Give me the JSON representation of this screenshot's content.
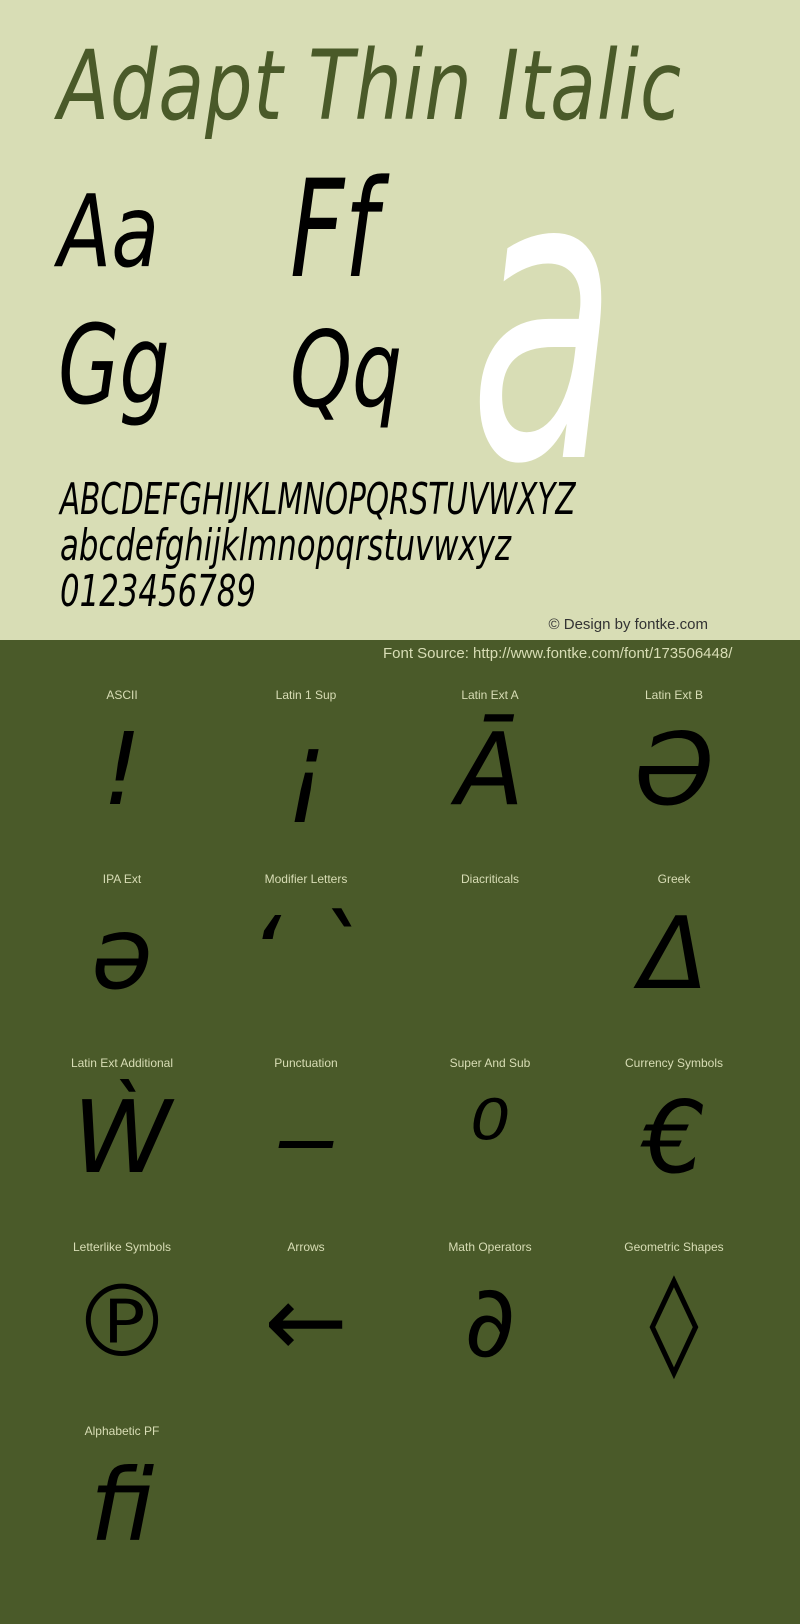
{
  "font_name": "Adapt Thin Italic",
  "colors": {
    "top_background": "#d8ddb5",
    "bottom_background": "#4a5a29",
    "title_color": "#4a5a29",
    "glyph_color": "#000000",
    "big_glyph_color": "#ffffff"
  },
  "sample_pairs": [
    "Aa",
    "Ff",
    "Gg",
    "Qq"
  ],
  "big_glyph": "a",
  "uppercase": "ABCDEFGHIJKLMNOPQRSTUVWXYZ",
  "lowercase": "abcdefghijklmnopqrstuvwxyz",
  "digits": "0123456789",
  "credit": "© Design by fontke.com",
  "source": "Font Source: http://www.fontke.com/font/173506448/",
  "blocks": [
    {
      "label": "ASCII",
      "glyph": "!"
    },
    {
      "label": "Latin 1 Sup",
      "glyph": "¡"
    },
    {
      "label": "Latin Ext A",
      "glyph": "Ā"
    },
    {
      "label": "Latin Ext B",
      "glyph": "Ə"
    },
    {
      "label": "IPA Ext",
      "glyph": "ə"
    },
    {
      "label": "Modifier Letters",
      "glyph": "ʻ ˋ"
    },
    {
      "label": "Diacriticals",
      "glyph": ""
    },
    {
      "label": "Greek",
      "glyph": "Δ"
    },
    {
      "label": "Latin Ext Additional",
      "glyph": "Ẁ"
    },
    {
      "label": "Punctuation",
      "glyph": "‒"
    },
    {
      "label": "Super And Sub",
      "glyph": "⁰"
    },
    {
      "label": "Currency Symbols",
      "glyph": "€"
    },
    {
      "label": "Letterlike Symbols",
      "glyph": "℗"
    },
    {
      "label": "Arrows",
      "glyph": "←"
    },
    {
      "label": "Math Operators",
      "glyph": "∂"
    },
    {
      "label": "Geometric Shapes",
      "glyph": "◊"
    },
    {
      "label": "Alphabetic PF",
      "glyph": "ﬁ"
    }
  ]
}
